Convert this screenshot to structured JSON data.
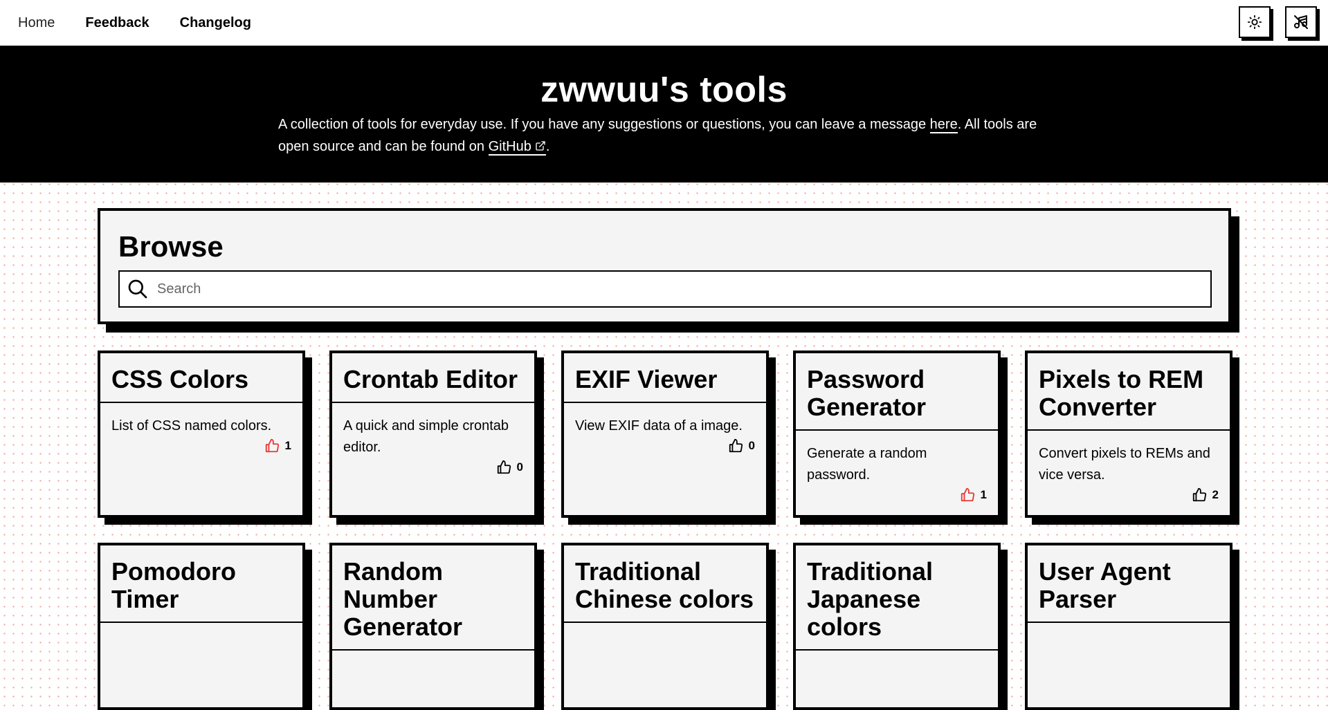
{
  "nav": {
    "home": "Home",
    "feedback": "Feedback",
    "changelog": "Changelog"
  },
  "hero": {
    "title": "zwwuu's tools",
    "desc_part1": "A collection of tools for everyday use. If you have any suggestions or questions, you can leave a message ",
    "here_link": "here",
    "desc_part2": ". All tools are open source and can be found on ",
    "github_link": "GitHub",
    "desc_part3": "."
  },
  "browse": {
    "title": "Browse",
    "search_placeholder": "Search"
  },
  "colors": {
    "liked": "#e53935",
    "default": "#000000"
  },
  "cards": [
    {
      "title": "CSS Colors",
      "desc": "List of CSS named colors.",
      "likes": "1",
      "liked": true
    },
    {
      "title": "Crontab Editor",
      "desc": "A quick and simple crontab editor.",
      "likes": "0",
      "liked": false
    },
    {
      "title": "EXIF Viewer",
      "desc": "View EXIF data of a image.",
      "likes": "0",
      "liked": false
    },
    {
      "title": "Password Generator",
      "desc": "Generate a random password.",
      "likes": "1",
      "liked": true
    },
    {
      "title": "Pixels to REM Converter",
      "desc": "Convert pixels to REMs and vice versa.",
      "likes": "2",
      "liked": false
    },
    {
      "title": "Pomodoro Timer",
      "desc": "",
      "likes": "",
      "liked": false
    },
    {
      "title": "Random Number Generator",
      "desc": "",
      "likes": "",
      "liked": false
    },
    {
      "title": "Traditional Chinese colors",
      "desc": "",
      "likes": "",
      "liked": false
    },
    {
      "title": "Traditional Japanese colors",
      "desc": "",
      "likes": "",
      "liked": false
    },
    {
      "title": "User Agent Parser",
      "desc": "",
      "likes": "",
      "liked": false
    }
  ]
}
